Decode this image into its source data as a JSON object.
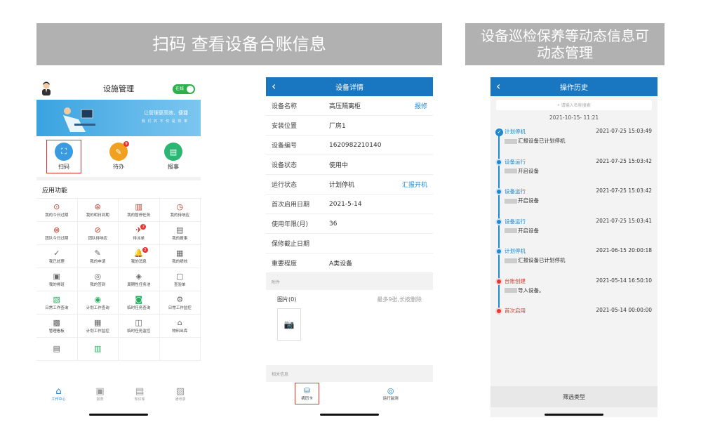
{
  "banners": {
    "left": "扫码 查看设备台账信息",
    "right_line1": "设备巡检保养等动态信息可",
    "right_line2": "动态管理"
  },
  "phone1": {
    "title": "设施管理",
    "toggle": "在线",
    "hero_line1": "让管理更高效、便捷",
    "hero_line2": "我 们 的 不 仅 是 效 率",
    "quick": [
      {
        "label": "扫码",
        "icon": "scan-icon",
        "color": "#3a9be0"
      },
      {
        "label": "待办",
        "icon": "todo-icon",
        "color": "#f2a020",
        "badge": "9"
      },
      {
        "label": "报事",
        "icon": "report-icon",
        "color": "#2bb673"
      }
    ],
    "section": "应用功能",
    "apps": [
      {
        "label": "我的今日过期",
        "icon": "⊙",
        "cls": ""
      },
      {
        "label": "我的明日到期",
        "icon": "⊛",
        "cls": ""
      },
      {
        "label": "我的暂停任务",
        "icon": "▥",
        "cls": ""
      },
      {
        "label": "我的待响应",
        "icon": "◷",
        "cls": ""
      },
      {
        "label": "团队今日过期",
        "icon": "⊗",
        "cls": ""
      },
      {
        "label": "团队待响应",
        "icon": "⊘",
        "cls": ""
      },
      {
        "label": "待派单",
        "icon": "✈",
        "cls": "",
        "badge": "2"
      },
      {
        "label": "我的报事",
        "icon": "▤",
        "cls": "gr"
      },
      {
        "label": "我已处理",
        "icon": "✓",
        "cls": "gr"
      },
      {
        "label": "我的申请",
        "icon": "✎",
        "cls": "gr"
      },
      {
        "label": "我的消息",
        "icon": "🔔",
        "cls": "gr",
        "badge": "3"
      },
      {
        "label": "我的绩效",
        "icon": "▦",
        "cls": "gr"
      },
      {
        "label": "我的排班",
        "icon": "▣",
        "cls": "gr"
      },
      {
        "label": "我的签到",
        "icon": "◎",
        "cls": "gr"
      },
      {
        "label": "周期性任务池",
        "icon": "◈",
        "cls": "gr"
      },
      {
        "label": "查验单",
        "icon": "▢",
        "cls": "gr"
      },
      {
        "label": "日常工作查询",
        "icon": "▧",
        "cls": "g"
      },
      {
        "label": "计划工作查询",
        "icon": "◉",
        "cls": "g"
      },
      {
        "label": "临时任务查询",
        "icon": "◙",
        "cls": "g"
      },
      {
        "label": "日常工作监控",
        "icon": "⚙",
        "cls": "gr"
      },
      {
        "label": "管理看板",
        "icon": "▩",
        "cls": "gr"
      },
      {
        "label": "计划工作监控",
        "icon": "▦",
        "cls": "gr"
      },
      {
        "label": "临时任务监控",
        "icon": "◫",
        "cls": "gr"
      },
      {
        "label": "物料出库",
        "icon": "⌂",
        "cls": "gr"
      },
      {
        "label": "",
        "icon": "▤",
        "cls": "gr"
      },
      {
        "label": "",
        "icon": "▥",
        "cls": "g"
      },
      {
        "label": "",
        "icon": "",
        "cls": ""
      },
      {
        "label": "",
        "icon": "",
        "cls": ""
      }
    ],
    "tabs": [
      {
        "label": "工作中心",
        "icon": "⌂",
        "on": true
      },
      {
        "label": "报表",
        "icon": "▣",
        "on": false
      },
      {
        "label": "知识库",
        "icon": "▤",
        "on": false
      },
      {
        "label": "通讯录",
        "icon": "▨",
        "on": false
      }
    ]
  },
  "phone2": {
    "title": "设备详情",
    "rows": [
      {
        "k": "设备名称",
        "v": "高压隔离柜",
        "a": "报修"
      },
      {
        "k": "安装位置",
        "v": "厂房1",
        "a": ""
      },
      {
        "k": "设备编号",
        "v": "1620982210140",
        "a": ""
      },
      {
        "k": "设备状态",
        "v": "使用中",
        "a": ""
      },
      {
        "k": "运行状态",
        "v": "计划停机",
        "a": "汇报开机"
      },
      {
        "k": "首次启用日期",
        "v": "2021-5-14",
        "a": ""
      },
      {
        "k": "使用年限(月)",
        "v": "36",
        "a": ""
      },
      {
        "k": "保修截止日期",
        "v": "",
        "a": ""
      },
      {
        "k": "重要程度",
        "v": "A类设备",
        "a": ""
      }
    ],
    "attach_label": "附件",
    "pic_label": "图片(0)",
    "pic_hint": "最多9张,长按删除",
    "related_label": "相关信息",
    "buttons": [
      {
        "label": "病历卡",
        "icon": "⛁"
      },
      {
        "label": "运行监测",
        "icon": "◎"
      }
    ]
  },
  "phone3": {
    "title": "操作历史",
    "search_placeholder": "请输入名称搜索",
    "date": "2021-10-15- 11:21",
    "filter": "筛选类型",
    "events": [
      {
        "type": "计划停机",
        "time": "2021-07-25 15:03:49",
        "desc": "汇报设备已计划停机",
        "red": false,
        "first": true
      },
      {
        "type": "设备运行",
        "time": "2021-07-25 15:03:42",
        "desc": "开启设备",
        "red": false
      },
      {
        "type": "设备运行",
        "time": "2021-07-25 15:03:42",
        "desc": "开启设备",
        "red": false
      },
      {
        "type": "设备运行",
        "time": "2021-07-25 15:03:41",
        "desc": "开启设备",
        "red": false
      },
      {
        "type": "计划停机",
        "time": "2021-06-15 20:00:18",
        "desc": "汇报设备已计划停机",
        "red": false
      },
      {
        "type": "台账创建",
        "time": "2021-05-14 16:50:10",
        "desc": "导入设备。",
        "red": true
      },
      {
        "type": "首次启用",
        "time": "2021-05-14 00:00:00",
        "desc": "",
        "red": true
      }
    ]
  }
}
